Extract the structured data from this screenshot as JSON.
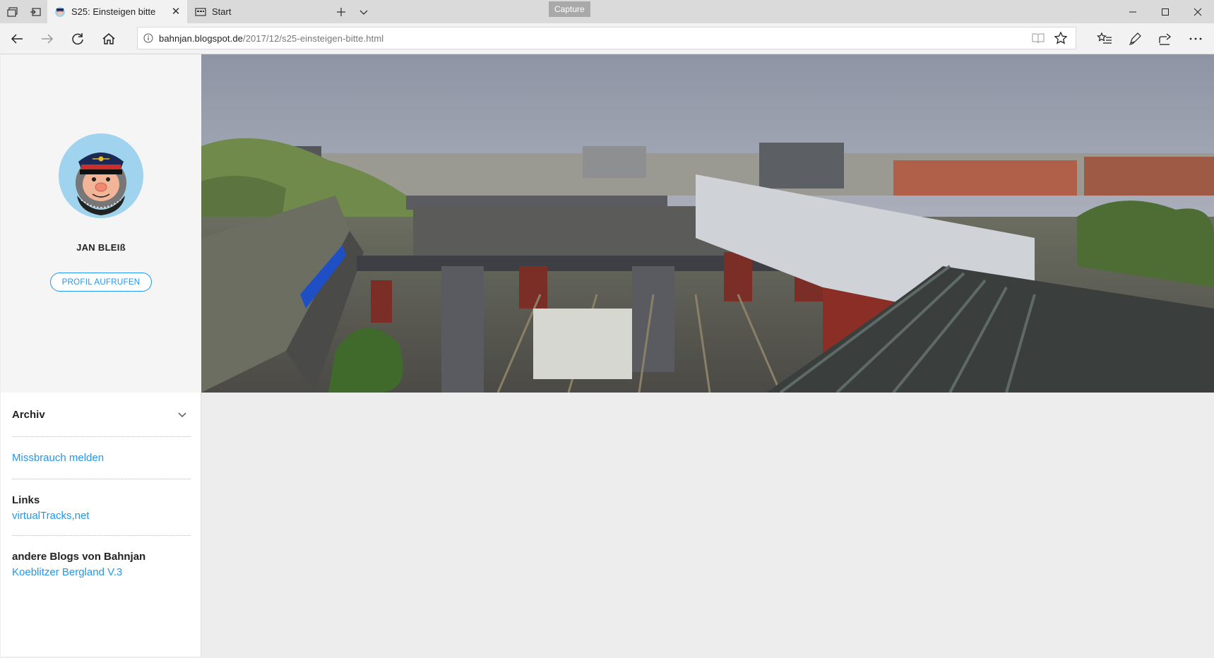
{
  "browser": {
    "tabs": [
      {
        "label": "S25: Einsteigen bitte",
        "active": true
      },
      {
        "label": "Start",
        "active": false
      }
    ],
    "capture_label": "Capture",
    "url_host": "bahnjan.blogspot.de",
    "url_path": "/2017/12/s25-einsteigen-bitte.html"
  },
  "sidebar": {
    "profile_name": "JAN BLEIß",
    "profile_button": "PROFIL AUFRUFEN",
    "archive_title": "Archiv",
    "report_link": "Missbrauch melden",
    "links_title": "Links",
    "links_item": "virtualTracks,net",
    "blogs_title": "andere Blogs von Bahnjan",
    "blogs_item": "Koeblitzer Bergland V.3"
  },
  "colors": {
    "accent": "#2196f3",
    "avatar_bg": "#9fd3ee",
    "page_bg": "#ededed"
  }
}
